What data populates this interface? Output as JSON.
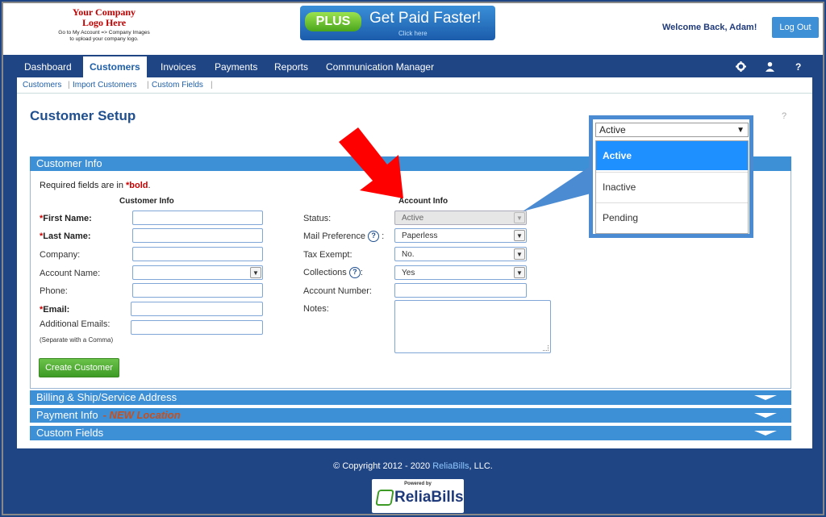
{
  "header": {
    "logo_line1": "Your Company",
    "logo_line2": "Logo Here",
    "logo_note1": "Go to My Account => Company Images",
    "logo_note2": "to upload your company logo.",
    "promo_badge": "PLUS",
    "promo_title": "Get Paid Faster!",
    "promo_sub": "Click here",
    "welcome": "Welcome Back, Adam!",
    "logout_label": "Log Out"
  },
  "nav": {
    "items": [
      "Dashboard",
      "Customers",
      "Invoices",
      "Payments",
      "Reports",
      "Communication Manager"
    ],
    "active": "Customers",
    "icons": [
      "gear-icon",
      "user-icon",
      "help-icon"
    ],
    "help_glyph": "?"
  },
  "subnav": {
    "items": [
      "Customers",
      "Import Customers",
      "Custom Fields"
    ]
  },
  "page": {
    "title": "Customer Setup",
    "help_glyph": "?"
  },
  "sections": {
    "customer_info": "Customer Info",
    "billing": "Billing & Ship/Service Address",
    "payment": "Payment Info",
    "payment_new": "- NEW Location",
    "custom_fields": "Custom Fields"
  },
  "form": {
    "required_note_prefix": "Required fields are in ",
    "required_note_bold": "*bold",
    "required_note_suffix": ".",
    "customer_col_head": "Customer Info",
    "account_col_head": "Account Info",
    "first_name_label": "First Name:",
    "last_name_label": "Last Name:",
    "company_label": "Company:",
    "account_name_label": "Account Name:",
    "phone_label": "Phone:",
    "email_label": "Email:",
    "additional_emails_label": "Additional Emails:",
    "additional_emails_note": "(Separate with a Comma)",
    "status_label": "Status:",
    "status_value": "Active",
    "mail_pref_label": "Mail Preference",
    "mail_pref_colon": ":",
    "mail_pref_value": "Paperless",
    "tax_exempt_label": "Tax Exempt:",
    "tax_exempt_value": "No.",
    "collections_label": "Collections",
    "collections_colon": ":",
    "collections_value": "Yes",
    "account_number_label": "Account Number:",
    "notes_label": "Notes:",
    "create_button": "Create Customer"
  },
  "callout": {
    "selected_value": "Active",
    "options": [
      "Active",
      "Inactive",
      "Pending"
    ]
  },
  "footer": {
    "copyright_prefix": "© Copyright 2012 - 2020 ",
    "brand": "ReliaBills",
    "copyright_suffix": ", LLC.",
    "powered_by": "Powered by",
    "powered_brand": "ReliaBills"
  },
  "colors": {
    "nav_bg": "#1f4585",
    "section_bar": "#3d8fd6",
    "accent_red": "#c00000",
    "arrow_red": "#ff0000",
    "selected_option": "#1e90ff"
  }
}
